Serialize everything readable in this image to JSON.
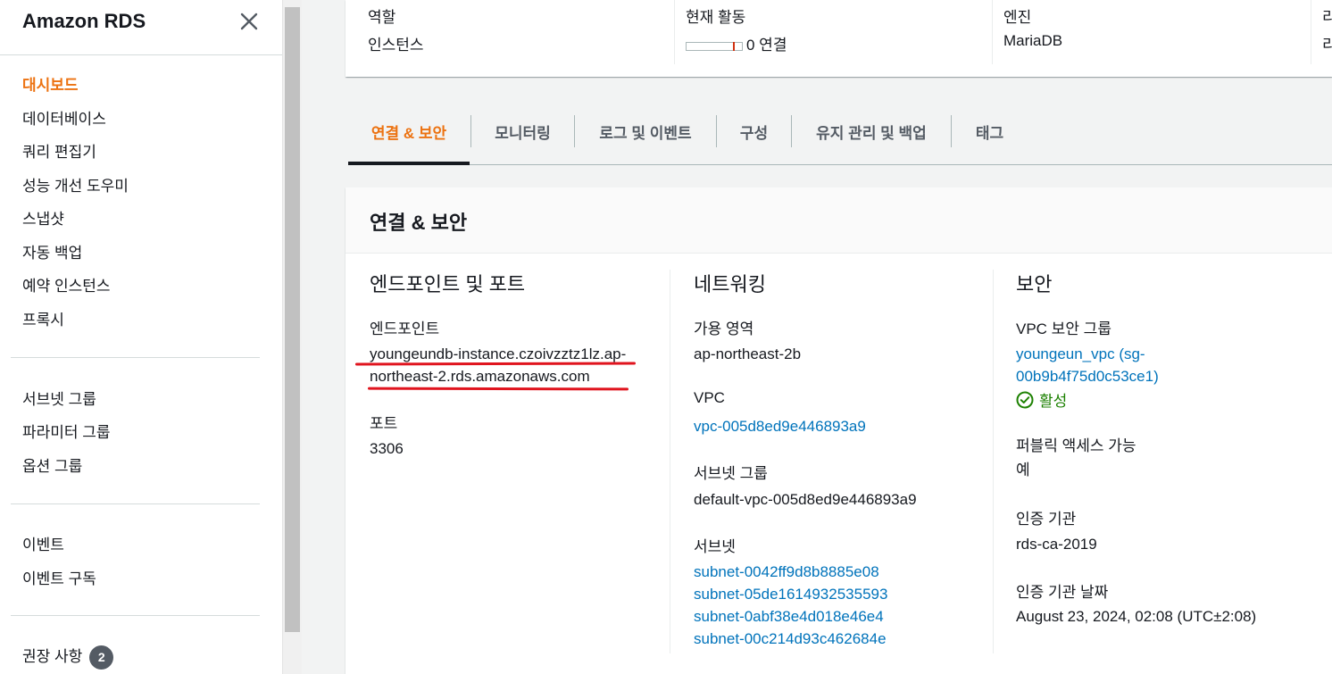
{
  "sidebar": {
    "title": "Amazon RDS",
    "items": [
      {
        "label": "대시보드",
        "active": true
      },
      {
        "label": "데이터베이스"
      },
      {
        "label": "쿼리 편집기"
      },
      {
        "label": "성능 개선 도우미"
      },
      {
        "label": "스냅샷"
      },
      {
        "label": "자동 백업"
      },
      {
        "label": "예약 인스턴스"
      },
      {
        "label": "프록시"
      },
      {
        "label": "서브넷 그룹"
      },
      {
        "label": "파라미터 그룹"
      },
      {
        "label": "옵션 그룹"
      },
      {
        "label": "이벤트"
      },
      {
        "label": "이벤트 구독"
      },
      {
        "label": "권장 사항",
        "badge": "2"
      }
    ]
  },
  "summary": {
    "role_label": "역할",
    "role_value": "인스턴스",
    "activity_label": "현재 활동",
    "activity_value": "0 연결",
    "engine_label": "엔진",
    "engine_value": "MariaDB",
    "region_label": "리",
    "region_value": "리"
  },
  "tabs": [
    {
      "label": "연결 & 보안",
      "active": true
    },
    {
      "label": "모니터링"
    },
    {
      "label": "로그 및 이벤트"
    },
    {
      "label": "구성"
    },
    {
      "label": "유지 관리 및 백업"
    },
    {
      "label": "태그"
    }
  ],
  "details": {
    "title": "연결 & 보안",
    "endpoint_section": {
      "title": "엔드포인트 및 포트",
      "endpoint_label": "엔드포인트",
      "endpoint_line1": "youngeundb-instance.czoivzztz1lz.ap-",
      "endpoint_line2": "northeast-2.rds.amazonaws.com",
      "port_label": "포트",
      "port_value": "3306"
    },
    "network_section": {
      "title": "네트워킹",
      "az_label": "가용 영역",
      "az_value": "ap-northeast-2b",
      "vpc_label": "VPC",
      "vpc_value": "vpc-005d8ed9e446893a9",
      "subnet_group_label": "서브넷 그룹",
      "subnet_group_value": "default-vpc-005d8ed9e446893a9",
      "subnets_label": "서브넷",
      "subnets": [
        "subnet-0042ff9d8b8885e08",
        "subnet-05de1614932535593",
        "subnet-0abf38e4d018e46e4",
        "subnet-00c214d93c462684e"
      ]
    },
    "security_section": {
      "title": "보안",
      "sg_label": "VPC 보안 그룹",
      "sg_line1": "youngeun_vpc (sg-",
      "sg_line2": "00b9b4f75d0c53ce1)",
      "sg_status": "활성",
      "public_label": "퍼블릭 액세스 가능",
      "public_value": "예",
      "ca_label": "인증 기관",
      "ca_value": "rds-ca-2019",
      "ca_date_label": "인증 기관 날짜",
      "ca_date_value": "August 23, 2024, 02:08 (UTC±2:08)"
    }
  },
  "colors": {
    "accent": "#ec7211",
    "link": "#0073bb",
    "success": "#1d8102",
    "annotation": "#e0141e"
  }
}
